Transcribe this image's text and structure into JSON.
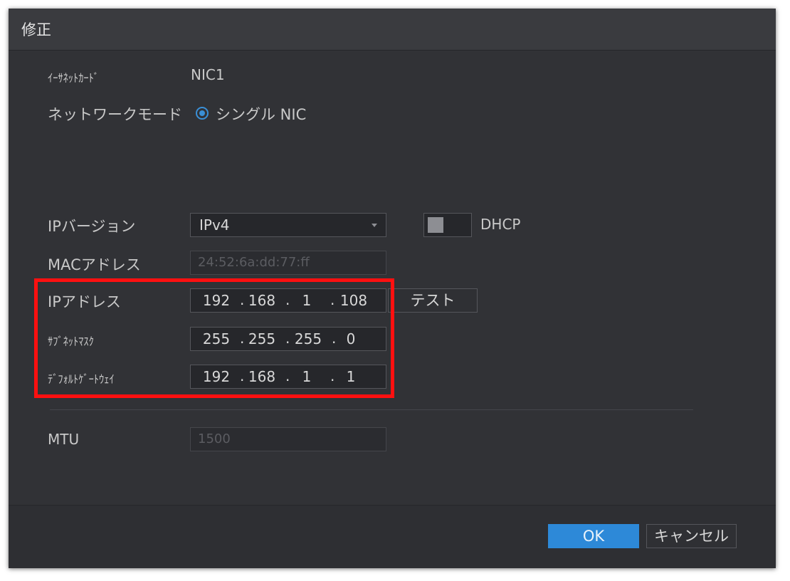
{
  "dialog": {
    "title": "修正"
  },
  "nic": {
    "label": "ｲｰｻﾈｯﾄｶｰﾄﾞ",
    "value": "NIC1"
  },
  "network_mode": {
    "label": "ネットワークモード",
    "option": "シングル NIC"
  },
  "ip_version": {
    "label": "IPバージョン",
    "value": "IPv4"
  },
  "dhcp": {
    "label": "DHCP",
    "enabled": false
  },
  "mac": {
    "label": "MACアドレス",
    "value": "24:52:6a:dd:77:ff"
  },
  "ip_address": {
    "label": "IPアドレス",
    "octets": [
      "192",
      "168",
      "1",
      "108"
    ]
  },
  "subnet_mask": {
    "label": "ｻﾌﾞﾈｯﾄﾏｽｸ",
    "octets": [
      "255",
      "255",
      "255",
      "0"
    ]
  },
  "gateway": {
    "label": "ﾃﾞﾌｫﾙﾄｹﾞｰﾄｳｪｲ",
    "octets": [
      "192",
      "168",
      "1",
      "1"
    ]
  },
  "test_button": {
    "label": "テスト"
  },
  "mtu": {
    "label": "MTU",
    "value": "1500"
  },
  "buttons": {
    "ok": "OK",
    "cancel": "キャンセル"
  },
  "colors": {
    "accent": "#2d89d8",
    "highlight": "#ff1010",
    "background": "#313236"
  }
}
